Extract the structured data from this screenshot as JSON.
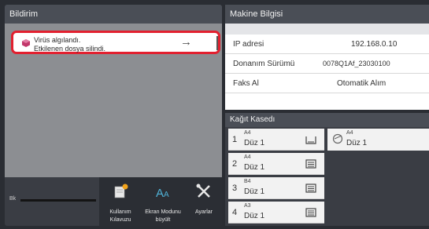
{
  "notification": {
    "header": "Bildirim",
    "line1": "Virüs algılandı.",
    "line2": "Etkilenen dosya silindi.",
    "arrow": "→"
  },
  "toner": {
    "label": "Bk"
  },
  "tools": [
    {
      "label1": "Kullanım",
      "label2": "Kılavuzu"
    },
    {
      "label1": "Ekran Modunu",
      "label2": "büyült"
    },
    {
      "label1": "Ayarlar",
      "label2": ""
    }
  ],
  "machine_info": {
    "header": "Makine Bilgisi",
    "rows": [
      {
        "key": "IP adresi",
        "value": "192.168.0.10"
      },
      {
        "key": "Donanım Sürümü",
        "value": "0078Q1Af_23030100"
      },
      {
        "key": "Faks Al",
        "value": "Otomatik Alım"
      }
    ]
  },
  "paper": {
    "header": "Kağıt Kasedı",
    "trays": [
      {
        "num": "1",
        "size": "A4",
        "type": "Düz 1"
      },
      {
        "num": "2",
        "size": "A4",
        "type": "Düz 1"
      },
      {
        "num": "3",
        "size": "B4",
        "type": "Düz 1"
      },
      {
        "num": "4",
        "size": "A3",
        "type": "Düz 1"
      }
    ],
    "bypass": {
      "size": "A4",
      "type": "Düz 1"
    }
  },
  "colors": {
    "alert": "#e2202f",
    "header": "#4a4e56",
    "panel": "#3a3d44"
  }
}
